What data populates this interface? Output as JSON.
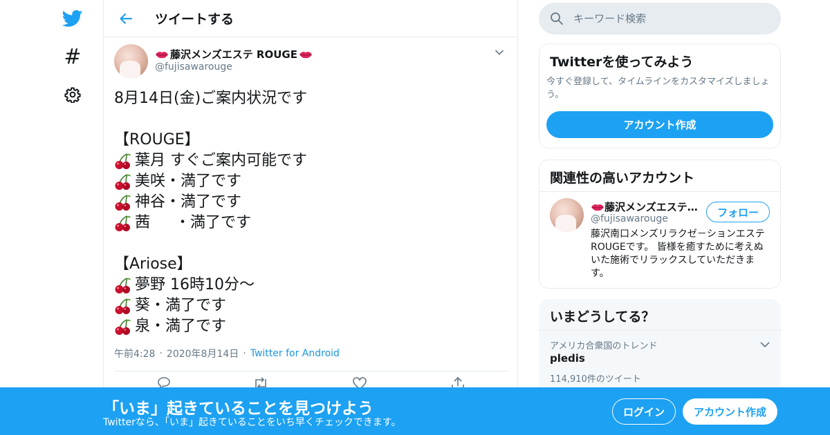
{
  "header": {
    "title": "ツイートする"
  },
  "search": {
    "placeholder": "キーワード検索"
  },
  "tweet": {
    "author_name": "藤沢メンズエステ ROUGE",
    "author_handle": "@fujisawarouge",
    "lines": [
      {
        "cherry": false,
        "text": "8月14日(金)ご案内状況です"
      },
      {
        "cherry": false,
        "text": ""
      },
      {
        "cherry": false,
        "text": "【ROUGE】"
      },
      {
        "cherry": true,
        "text": "葉月 すぐご案内可能です"
      },
      {
        "cherry": true,
        "text": "美咲・満了です"
      },
      {
        "cherry": true,
        "text": "神谷・満了です"
      },
      {
        "cherry": true,
        "text": "茜　  ・満了です"
      },
      {
        "cherry": false,
        "text": ""
      },
      {
        "cherry": false,
        "text": "【Ariose】"
      },
      {
        "cherry": true,
        "text": "夢野 16時10分～"
      },
      {
        "cherry": true,
        "text": "葵・満了です"
      },
      {
        "cherry": true,
        "text": "泉・満了です"
      }
    ],
    "time": "午前4:28",
    "date": "2020年8月14日",
    "source": "Twitter for Android"
  },
  "signup_card": {
    "title": "Twitterを使ってみよう",
    "description": "今すぐ登録して、タイムラインをカスタマイズしましょう。",
    "button": "アカウント作成"
  },
  "related_card": {
    "title": "関連性の高いアカウント",
    "name": "藤沢メンズエステ…",
    "handle": "@fujisawarouge",
    "follow": "フォロー",
    "bio": "藤沢南口メンズリラクゼ－ションエステROUGEです。 皆様を癒すために考えぬいた施術でリラックスしていただきます。"
  },
  "trends_card": {
    "title": "いまどうしてる？",
    "context": "アメリカ合衆国のトレンド",
    "name": "pledis",
    "count": "114,910件のツイート"
  },
  "banner": {
    "title": "「いま」起きていることを見つけよう",
    "subtitle": "Twitterなら、「いま」起きていることをいち早くチェックできます。",
    "login": "ログイン",
    "signup": "アカウント作成"
  },
  "colors": {
    "accent": "#1da1f2",
    "secondary_text": "#657786",
    "border": "#e6ecf0"
  }
}
